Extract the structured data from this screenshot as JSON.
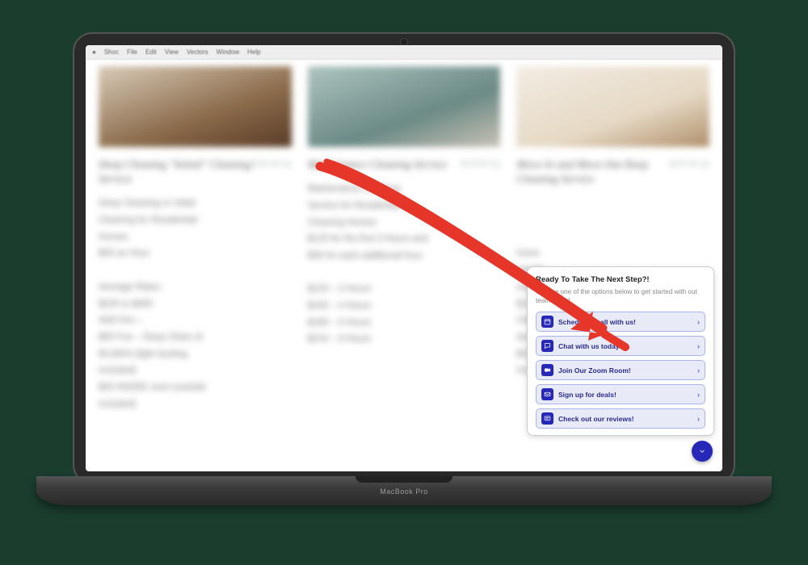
{
  "laptop": {
    "brand_label": "MacBook Pro"
  },
  "menubar": {
    "items": [
      "",
      "Shoc",
      "File",
      "Edit",
      "View",
      "Vectors",
      "Window",
      "Help"
    ]
  },
  "services": [
    {
      "title": "Deep Cleaning \"Initial\" Cleaning Service",
      "price_tag": "$225 & Up",
      "body": "Deep Cleaning or Initial\nCleaning for Residential\nHomes\n$45 an Hour\n\nAverage Rates:\n$220 to $400\nAdd Ons –\n$50 Fee – Deep Clean of\nBLINDS (light dusting\nincluded)\n$25 INSIDE oven (outside\nincluded)"
    },
    {
      "title": "Maintenance Cleaning Service",
      "price_tag": "$120 & Up",
      "body": "Maintenance Cleaning\nService for Residential\nCleaning Homes\n$120 for the first 3 Hours and\n$30 for each additional hour\n\n$120 – 3 Hours\n$150 – 4 Hours\n$180 – 5 Hours\n$210 – 6 Hours"
    },
    {
      "title": "Move In and Move Out Deep Cleaning Service",
      "price_tag": "$225 & Up",
      "body": "\n\n\nhome\ndetails\nestimate\n$120\nClean\ndust\n$25 INSIDE oven (outside\nincluded)"
    }
  ],
  "popup": {
    "title": "Ready To Take The Next Step?!",
    "subtitle": "Choose one of the options below to get started with out team today!",
    "options": [
      {
        "icon": "calendar",
        "label": "Schedule a call with us!"
      },
      {
        "icon": "chat",
        "label": "Chat with us today!"
      },
      {
        "icon": "video",
        "label": "Join Our Zoom Room!"
      },
      {
        "icon": "mail",
        "label": "Sign up for deals!"
      },
      {
        "icon": "review",
        "label": "Check out our reviews!"
      }
    ]
  },
  "annotation": {
    "stroke": "#e53629",
    "note": "hand-drawn red arrow pointing from upper-left content to the popup widget"
  }
}
